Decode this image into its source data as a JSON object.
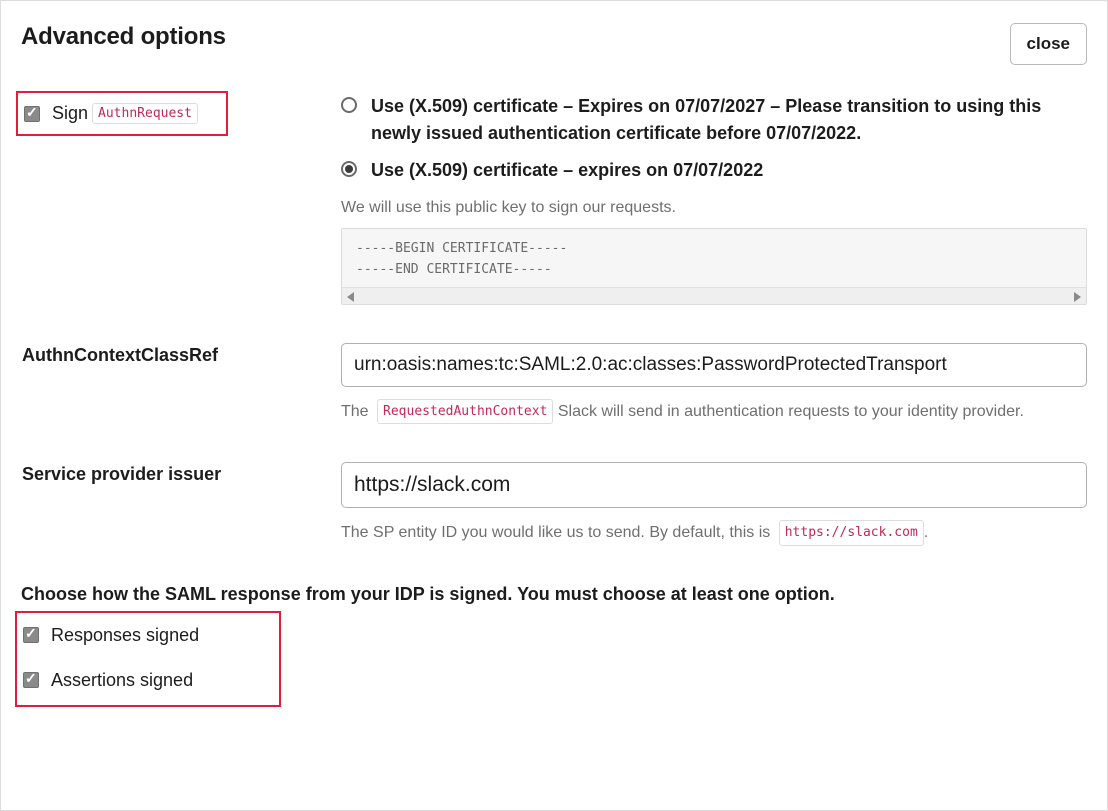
{
  "header": {
    "title": "Advanced options",
    "close_label": "close"
  },
  "sign": {
    "label_text": "Sign",
    "label_code": "AuthnRequest",
    "certs": [
      {
        "text": "Use (X.509) certificate – Expires on 07/07/2027 – Please transition to using this newly issued authentication certificate before 07/07/2022.",
        "selected": false
      },
      {
        "text": "Use (X.509) certificate – expires on 07/07/2022",
        "selected": true
      }
    ],
    "help": "We will use this public key to sign our requests.",
    "cert_body": "-----BEGIN CERTIFICATE-----\n-----END CERTIFICATE-----"
  },
  "authn_ref": {
    "label": "AuthnContextClassRef",
    "value": "urn:oasis:names:tc:SAML:2.0:ac:classes:PasswordProtectedTransport",
    "help_prefix": "The",
    "help_code": "RequestedAuthnContext",
    "help_suffix": "Slack will send in authentication requests to your identity provider."
  },
  "sp_issuer": {
    "label": "Service provider issuer",
    "value": "https://slack.com",
    "help_prefix": "The SP entity ID you would like us to send. By default, this is",
    "help_code": "https://slack.com",
    "help_suffix": "."
  },
  "signing": {
    "heading": "Choose how the SAML response from your IDP is signed. You must choose at least one option.",
    "responses_label": "Responses signed",
    "assertions_label": "Assertions signed"
  }
}
